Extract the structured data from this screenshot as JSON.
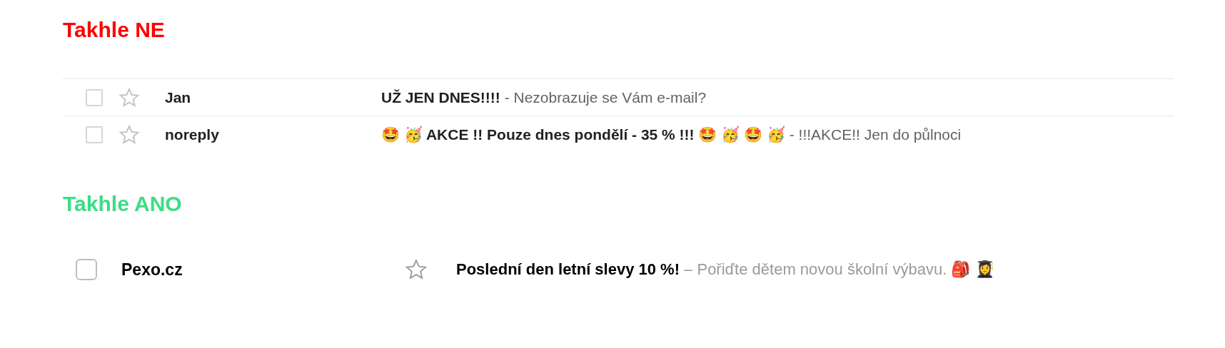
{
  "sections": [
    {
      "heading": "Takhle NE",
      "kind": "bad",
      "rows": [
        {
          "checked": false,
          "starred": false,
          "sender": "Jan",
          "subject": "**UŽ JEN DNES!!!!** - Nezobrazuje se Vám e-mail?"
        },
        {
          "checked": false,
          "starred": false,
          "sender": "noreply",
          "subject": "**🤩 🥳 AKCE !! Pouze dnes pondělí - 35 % !!! 🤩 🥳 🤩 🥳** - !!!AKCE!! Jen do půlnoci"
        }
      ]
    },
    {
      "heading": "Takhle ANO",
      "kind": "good",
      "rows": [
        {
          "checked": false,
          "starred": false,
          "sender": "Pexo.cz",
          "subject": "**Poslední den letní slevy 10 %!** – Pořiďte dětem novou školní výbavu. 🎒 👩‍🎓"
        }
      ]
    }
  ]
}
